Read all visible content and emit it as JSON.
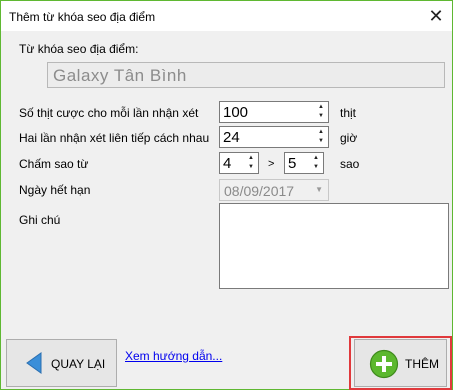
{
  "window": {
    "title": "Thêm từ khóa seo địa điểm",
    "close_glyph": "✕"
  },
  "keyword": {
    "label": "Từ khóa seo địa điểm:",
    "value": "Galaxy Tân Bình"
  },
  "cost": {
    "label": "Số thịt cược cho mỗi lần nhận xét",
    "value": "100",
    "unit": "thịt"
  },
  "interval": {
    "label": "Hai lần nhận xét liên tiếp cách nhau",
    "value": "24",
    "unit": "giờ"
  },
  "stars": {
    "label": "Chấm sao từ",
    "from": "4",
    "separator": ">",
    "to": "5",
    "unit": "sao"
  },
  "expiry": {
    "label": "Ngày hết hạn",
    "value": "08/09/2017"
  },
  "notes": {
    "label": "Ghi chú",
    "value": ""
  },
  "buttons": {
    "back": "QUAY LẠI",
    "add": "THÊM"
  },
  "help_link": "Xem hướng dẫn...",
  "colors": {
    "window_border": "#5fb832",
    "highlight": "#e0393c",
    "back_icon": "#3b8fd9",
    "add_icon": "#5cb82e"
  },
  "icons": [
    "close-icon",
    "spin-arrows-icon",
    "dropdown-arrow-icon",
    "back-arrow-icon",
    "plus-circle-icon"
  ]
}
